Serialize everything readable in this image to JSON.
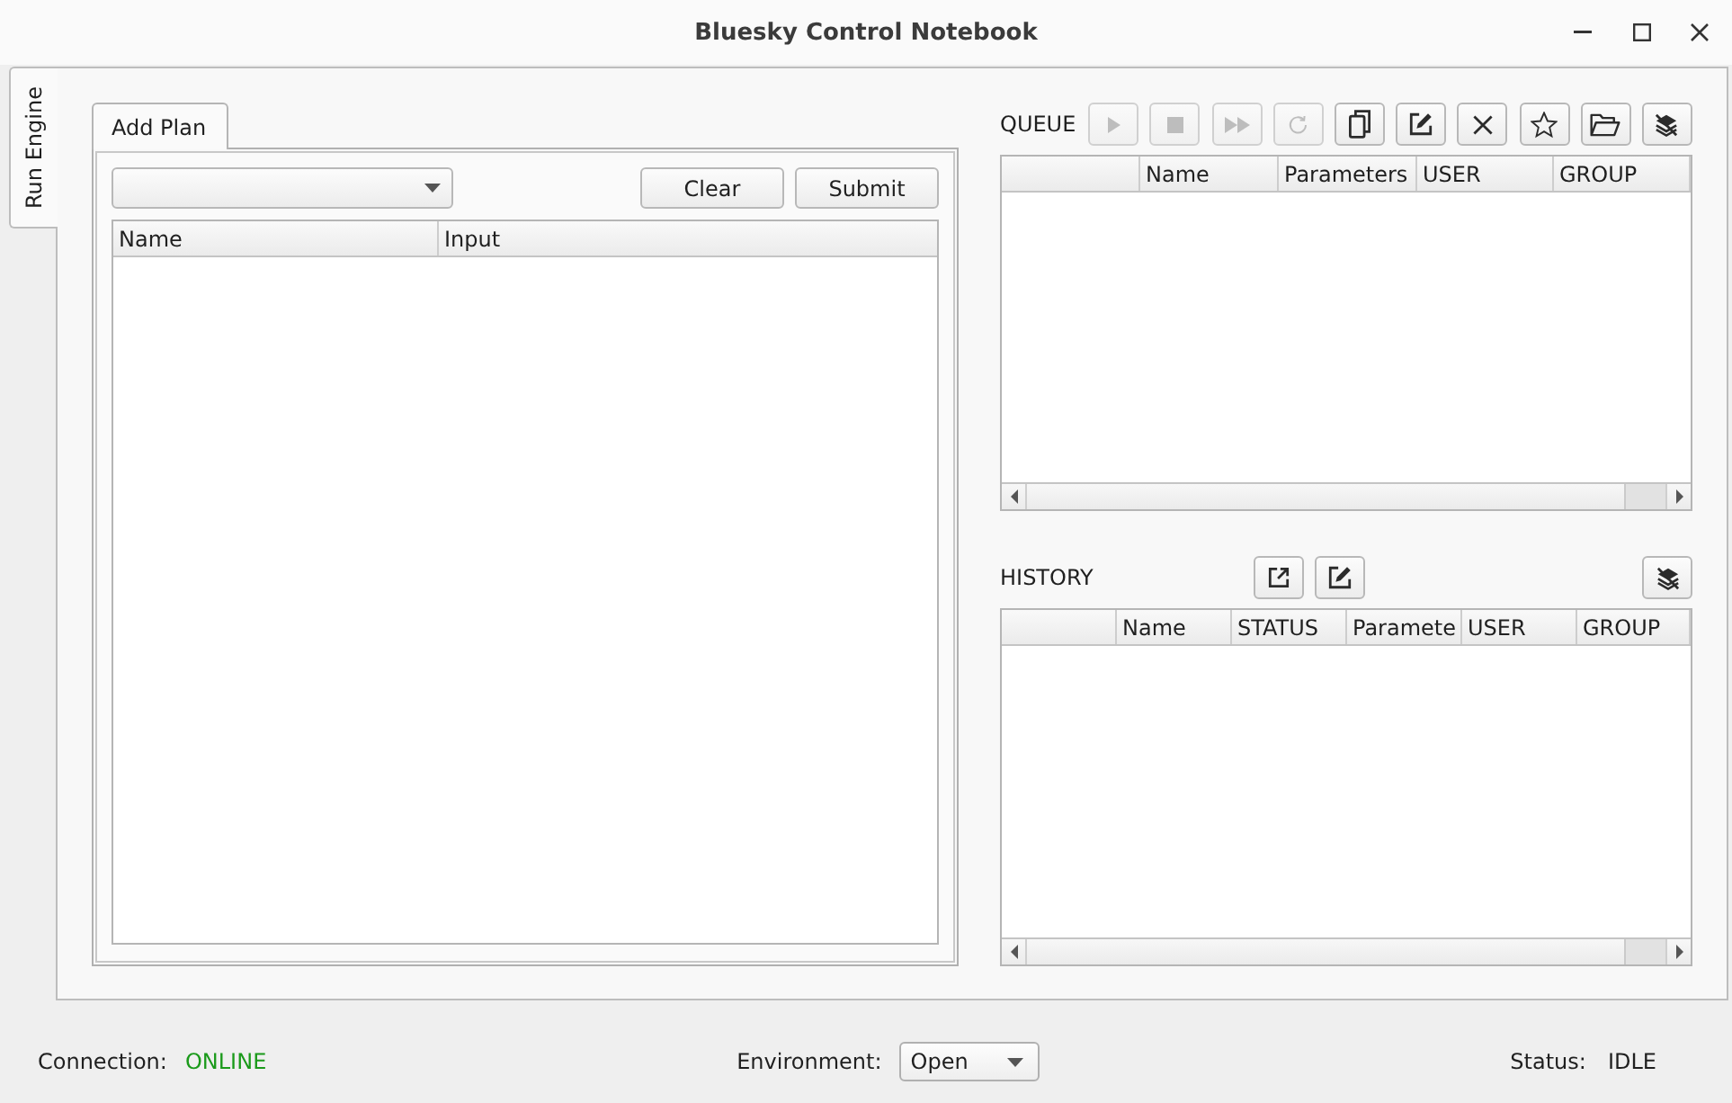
{
  "window": {
    "title": "Bluesky Control Notebook"
  },
  "side_tabs": [
    {
      "label": "Run Engine",
      "selected": true
    }
  ],
  "plan_panel": {
    "tabs": [
      {
        "label": "Add Plan",
        "selected": true
      }
    ],
    "buttons": [
      {
        "label": "Clear"
      },
      {
        "label": "Submit"
      }
    ],
    "table": {
      "columns": [
        "Name",
        "Input"
      ]
    }
  },
  "queue": {
    "title": "QUEUE",
    "toolbar": [
      {
        "kind": "play",
        "disabled": true
      },
      {
        "kind": "stop",
        "disabled": true
      },
      {
        "kind": "fast_forward",
        "disabled": true
      },
      {
        "kind": "reload",
        "disabled": true
      },
      {
        "kind": "copy",
        "disabled": false
      },
      {
        "kind": "edit",
        "disabled": false
      },
      {
        "kind": "x",
        "disabled": false
      },
      {
        "kind": "star",
        "disabled": false
      },
      {
        "kind": "folder",
        "disabled": false
      },
      {
        "kind": "layers_slash",
        "disabled": false
      }
    ],
    "table": {
      "columns": [
        "Name",
        "Parameters",
        "USER",
        "GROUP"
      ]
    }
  },
  "history": {
    "title": "HISTORY",
    "toolbar": [
      {
        "kind": "export",
        "disabled": false
      },
      {
        "kind": "edit",
        "disabled": false
      }
    ],
    "toolbar_end": [
      {
        "kind": "layers_slash",
        "disabled": false
      }
    ],
    "table": {
      "columns": [
        "Name",
        "STATUS",
        "Paramete",
        "USER",
        "GROUP"
      ]
    }
  },
  "status_bar": {
    "connection": {
      "label": "Connection:",
      "value": "ONLINE",
      "online": true
    },
    "environment": {
      "label": "Environment:",
      "value": "Open"
    },
    "status": {
      "label": "Status:",
      "value": "IDLE"
    }
  }
}
